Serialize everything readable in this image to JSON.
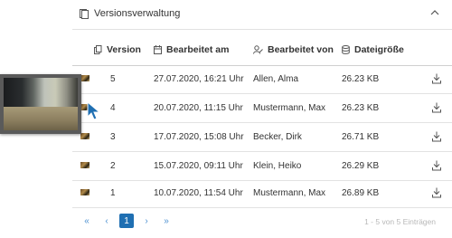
{
  "panel": {
    "title": "Versionsverwaltung",
    "icons": [
      "document-icon",
      "chevron-up-icon"
    ]
  },
  "table": {
    "columns": [
      {
        "label": "Version",
        "icon": "copy-icon"
      },
      {
        "label": "Bearbeitet am",
        "icon": "calendar-icon"
      },
      {
        "label": "Bearbeitet von",
        "icon": "user-edit-icon"
      },
      {
        "label": "Dateigröße",
        "icon": "database-icon"
      }
    ],
    "rows": [
      {
        "version": "5",
        "date": "27.07.2020, 16:21 Uhr",
        "user": "Allen, Alma",
        "size": "26.23 KB"
      },
      {
        "version": "4",
        "date": "20.07.2020, 11:15 Uhr",
        "user": "Mustermann, Max",
        "size": "26.23 KB"
      },
      {
        "version": "3",
        "date": "17.07.2020, 15:08 Uhr",
        "user": "Becker, Dirk",
        "size": "26.71 KB"
      },
      {
        "version": "2",
        "date": "15.07.2020, 09:11 Uhr",
        "user": "Klein, Heiko",
        "size": "26.29 KB"
      },
      {
        "version": "1",
        "date": "10.07.2020, 11:54 Uhr",
        "user": "Mustermann, Max",
        "size": "26.89 KB"
      }
    ]
  },
  "pager": {
    "first": "«",
    "prev": "‹",
    "current": "1",
    "next": "›",
    "last": "»",
    "entries_label": "1 - 5 von 5 Einträgen"
  },
  "colors": {
    "accent": "#1f6fb2",
    "link": "#4a8fd0",
    "border": "#e2e2e2",
    "text": "#333333"
  }
}
